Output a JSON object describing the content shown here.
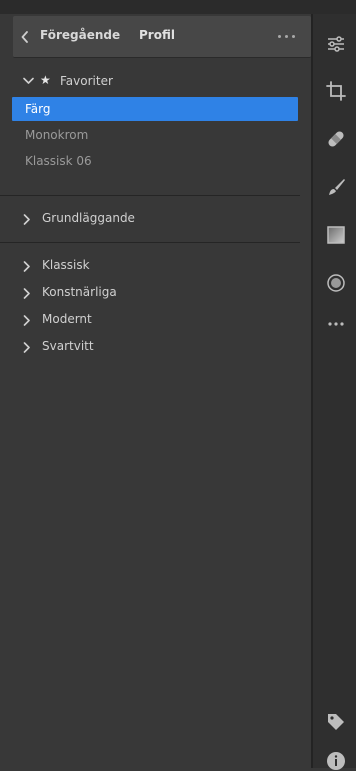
{
  "header": {
    "back_label": "Föregående",
    "title": "Profil"
  },
  "favorites": {
    "label": "Favoriter",
    "items": [
      {
        "label": "Färg",
        "selected": true
      },
      {
        "label": "Monokrom",
        "selected": false
      },
      {
        "label": "Klassisk 06",
        "selected": false
      }
    ]
  },
  "groups": [
    {
      "label": "Grundläggande"
    },
    {
      "label": "Klassisk"
    },
    {
      "label": "Konstnärliga"
    },
    {
      "label": "Modernt"
    },
    {
      "label": "Svartvitt"
    }
  ],
  "rail": {
    "icons": [
      "edit-sliders-icon",
      "crop-icon",
      "healing-bandage-icon",
      "brush-icon",
      "gradient-icon",
      "radial-icon",
      "more-icon",
      "tag-icon",
      "info-icon"
    ]
  },
  "colors": {
    "accent": "#2f82e6",
    "panel_bg": "#383838",
    "header_bg": "#474747",
    "rail_bg": "#2f2f2f"
  }
}
